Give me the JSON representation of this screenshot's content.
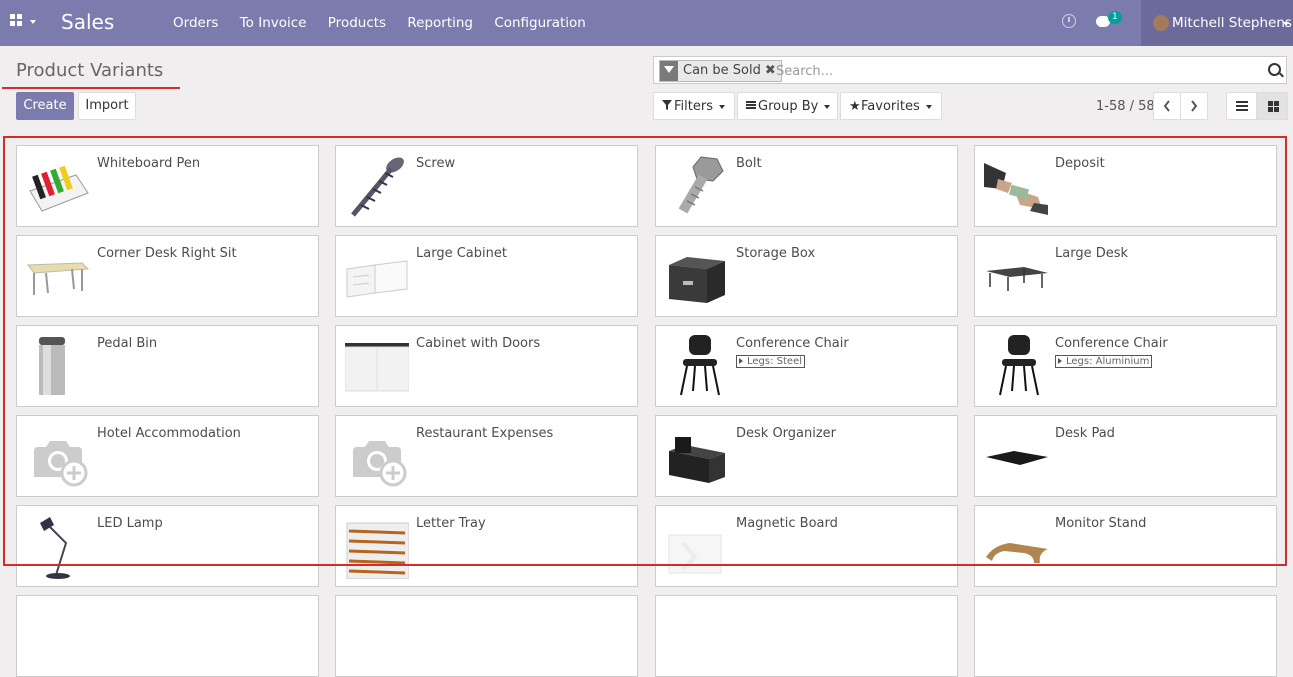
{
  "navbar": {
    "app_name": "Sales",
    "menu": [
      "Orders",
      "To Invoice",
      "Products",
      "Reporting",
      "Configuration"
    ],
    "chat_count": "1",
    "user_name": "Mitchell Stephens",
    "icons": [
      "apps-icon",
      "clock-icon",
      "chat-icon",
      "avatar"
    ]
  },
  "control_panel": {
    "title": "Product Variants",
    "create_label": "Create",
    "import_label": "Import",
    "search": {
      "facet_label": "Can be Sold",
      "facet_remove": "✖",
      "placeholder": "Search..."
    },
    "filters_label": "Filters",
    "groupby_label": "Group By",
    "favorites_label": "Favorites",
    "pager": "1-58 / 58",
    "accent_color": "#7c7bad",
    "highlight_color": "#d62b2b"
  },
  "products": [
    {
      "name": "Whiteboard Pen",
      "image": "markers"
    },
    {
      "name": "Screw",
      "image": "screw"
    },
    {
      "name": "Bolt",
      "image": "bolt"
    },
    {
      "name": "Deposit",
      "image": "money-hands"
    },
    {
      "name": "Corner Desk Right Sit",
      "image": "corner-desk"
    },
    {
      "name": "Large Cabinet",
      "image": "cabinet-white"
    },
    {
      "name": "Storage Box",
      "image": "storage-box"
    },
    {
      "name": "Large Desk",
      "image": "large-desk"
    },
    {
      "name": "Pedal Bin",
      "image": "pedal-bin"
    },
    {
      "name": "Cabinet with Doors",
      "image": "cabinet-doors"
    },
    {
      "name": "Conference Chair",
      "attribute": "Legs: Steel",
      "image": "chair"
    },
    {
      "name": "Conference Chair",
      "attribute": "Legs: Aluminium",
      "image": "chair"
    },
    {
      "name": "Hotel Accommodation",
      "image": "placeholder-camera"
    },
    {
      "name": "Restaurant Expenses",
      "image": "placeholder-camera"
    },
    {
      "name": "Desk Organizer",
      "image": "desk-organizer"
    },
    {
      "name": "Desk Pad",
      "image": "desk-pad"
    },
    {
      "name": "LED Lamp",
      "image": "led-lamp"
    },
    {
      "name": "Letter Tray",
      "image": "letter-tray"
    },
    {
      "name": "Magnetic Board",
      "image": "magnetic-board"
    },
    {
      "name": "Monitor Stand",
      "image": "monitor-stand"
    }
  ]
}
